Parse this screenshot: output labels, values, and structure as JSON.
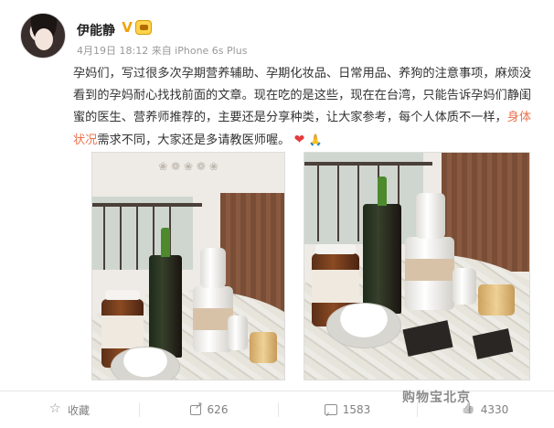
{
  "user": {
    "name": "伊能静",
    "verified_icon": "verified-v-icon",
    "badge_icon": "member-badge-icon"
  },
  "post": {
    "meta": "4月19日 18:12 来自 iPhone 6s Plus",
    "text_part1": "孕妈们，写过很多次孕期营养辅助、孕期化妆品、日常用品、养狗的注意事项，麻烦没看到的孕妈耐心找找前面的文章。现在吃的是这些，现在在台湾，只能告诉孕妈们静闺蜜的医生、营养师推荐的，主要还是分享种类，让大家参考，每个人体质不一样，",
    "text_highlight": "身体状况",
    "text_part2": "需求不同，大家还是多请教医师喔。",
    "emoji_heart": "❤",
    "emoji_pray": "🙏"
  },
  "actions": {
    "favorite_label": "收藏",
    "share_count": "626",
    "comment_count": "1583",
    "like_count": "4330"
  },
  "watermark": "购物宝北京",
  "colors": {
    "link_highlight": "#eb7350",
    "verified": "#f0a30a",
    "muted_text": "#999999"
  }
}
